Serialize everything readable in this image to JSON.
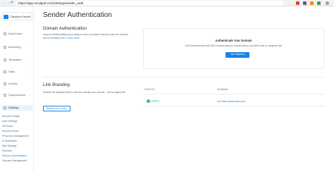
{
  "browser": {
    "url": "https://app.sendgrid.com/settings/sender_auth",
    "back_glyph": "←",
    "forward_glyph": "→",
    "reload_glyph": "⟳"
  },
  "sidebar": {
    "user_name": "Claudiou Pernell",
    "chevron": "⌄",
    "items": [
      {
        "label": "Dashboard",
        "icon": "dashboard-icon"
      },
      {
        "label": "Marketing",
        "icon": "megaphone-icon"
      },
      {
        "label": "Templates",
        "icon": "template-icon"
      },
      {
        "label": "Stats",
        "icon": "stats-icon"
      },
      {
        "label": "Activity",
        "icon": "activity-icon"
      },
      {
        "label": "Suppressions",
        "icon": "suppression-icon"
      },
      {
        "label": "Settings",
        "icon": "gear-icon"
      }
    ],
    "settings_sub": [
      "Account Details",
      "Alert Settings",
      "API Keys",
      "Inbound Parse",
      "IP Access Management",
      "IP Addresses",
      "Mail Settings",
      "Partners",
      "Sender Authentication",
      "Subuser Management"
    ]
  },
  "main": {
    "title": "Sender Authentication",
    "domain_auth": {
      "title": "Domain Authentication",
      "desc": "Improve deliverability by proving to inbox providers that you own the domain you're sending from.",
      "link": "Learn more",
      "card_title": "Authenticate Your Domain",
      "card_desc": "You'll be presented with DNS records that you should add to your DNS host to complete this.",
      "button": "Get Started"
    },
    "link_branding": {
      "title": "Link Branding",
      "desc": "Rewrite all tracking links to use the domain you choose - not sendgrid.net",
      "button": "Brand Your Links",
      "col_status": "STATUS",
      "col_domain": "DOMAIN",
      "row_status": "Verified",
      "row_domain": "url1.links.sitedomain.com"
    }
  }
}
